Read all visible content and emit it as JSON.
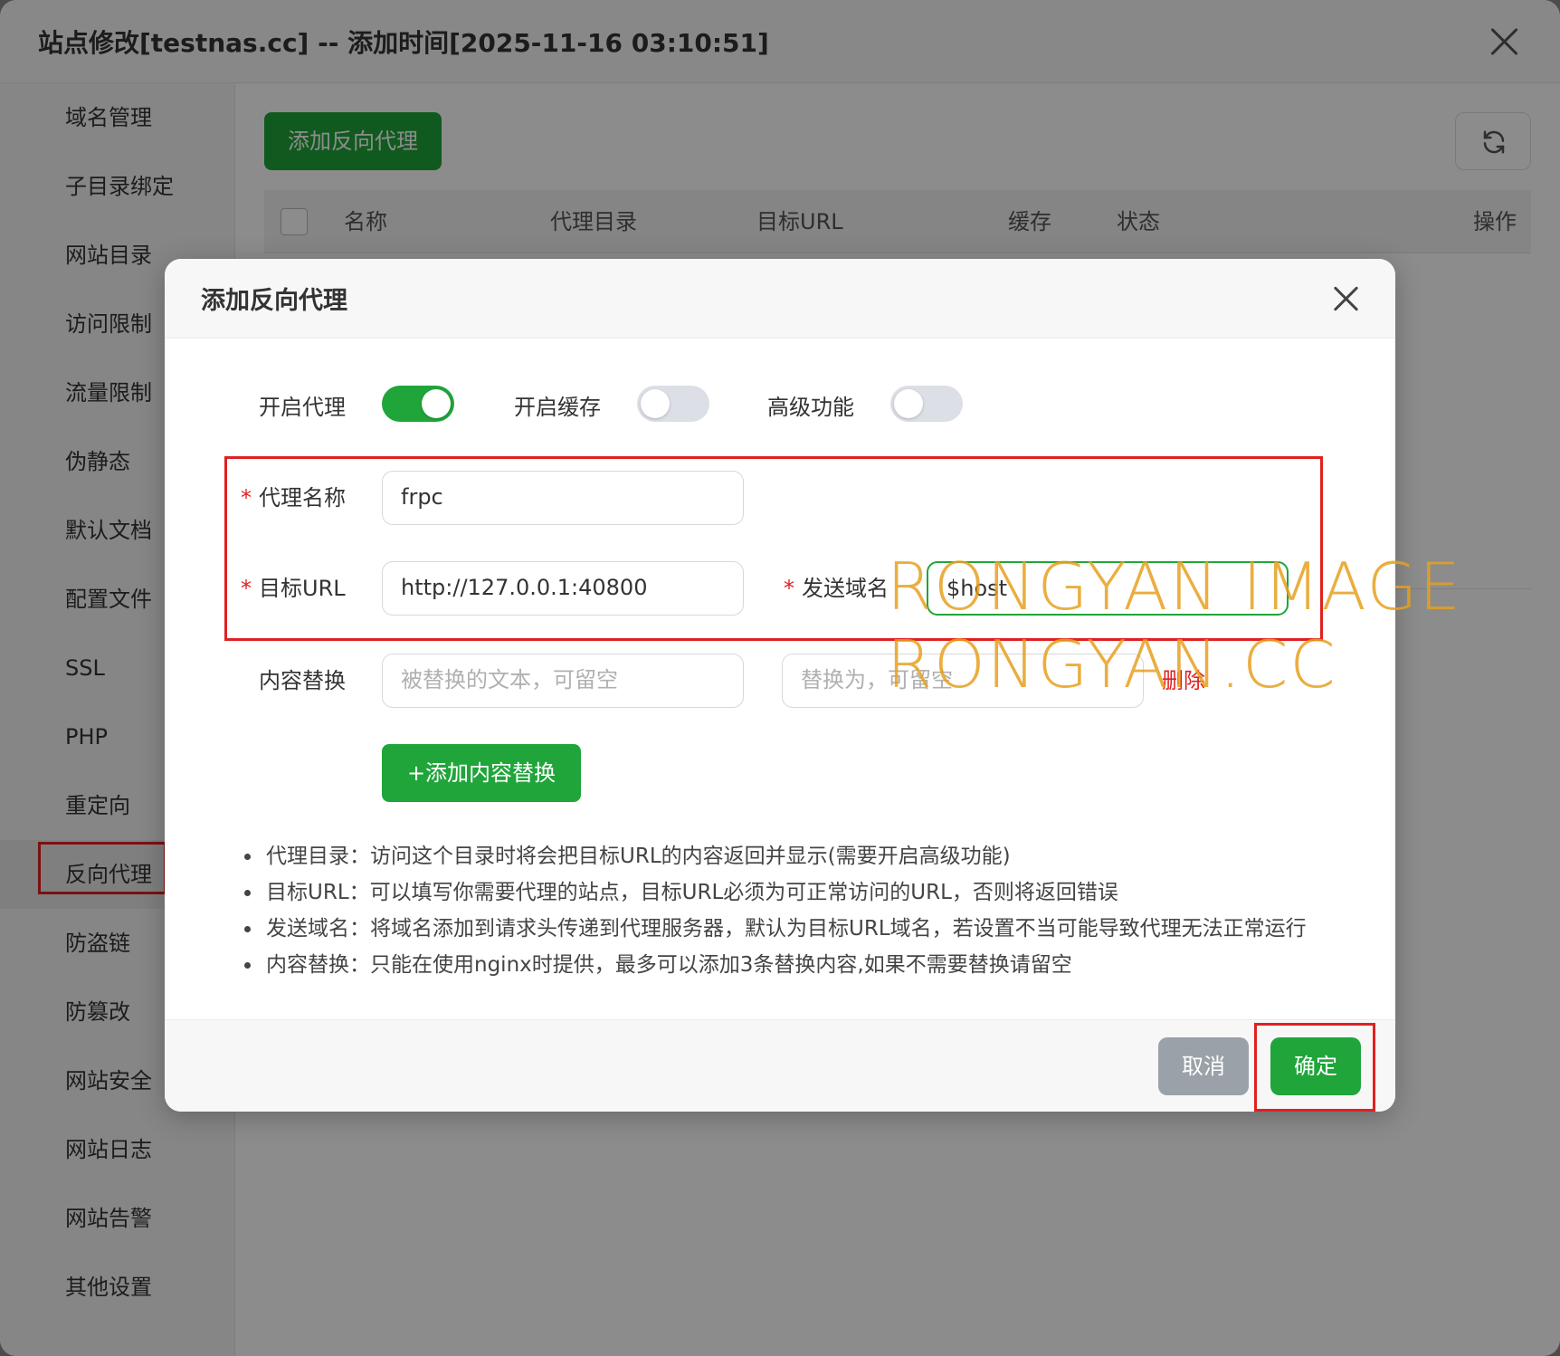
{
  "window": {
    "title": "站点修改[testnas.cc] -- 添加时间[2025-11-16 03:10:51]"
  },
  "sidebar": {
    "items": [
      {
        "label": "域名管理"
      },
      {
        "label": "子目录绑定"
      },
      {
        "label": "网站目录"
      },
      {
        "label": "访问限制"
      },
      {
        "label": "流量限制"
      },
      {
        "label": "伪静态"
      },
      {
        "label": "默认文档"
      },
      {
        "label": "配置文件"
      },
      {
        "label": "SSL"
      },
      {
        "label": "PHP"
      },
      {
        "label": "重定向"
      },
      {
        "label": "反向代理"
      },
      {
        "label": "防盗链"
      },
      {
        "label": "防篡改"
      },
      {
        "label": "网站安全"
      },
      {
        "label": "网站日志"
      },
      {
        "label": "网站告警"
      },
      {
        "label": "其他设置"
      }
    ],
    "active": "反向代理"
  },
  "main": {
    "add_button": "添加反向代理",
    "refresh_icon": "refresh-icon",
    "table_headers": [
      "名称",
      "代理目录",
      "目标URL",
      "缓存",
      "状态",
      "操作"
    ]
  },
  "modal": {
    "title": "添加反向代理",
    "toggles": [
      {
        "label": "开启代理",
        "on": true
      },
      {
        "label": "开启缓存",
        "on": false
      },
      {
        "label": "高级功能",
        "on": false
      }
    ],
    "proxy_name": {
      "label": "代理名称",
      "value": "frpc"
    },
    "target_url": {
      "label": "目标URL",
      "value": "http://127.0.0.1:40800"
    },
    "send_domain": {
      "label": "发送域名",
      "value": "$host"
    },
    "content_replace": {
      "label": "内容替换",
      "from_placeholder": "被替换的文本，可留空",
      "to_placeholder": "替换为，可留空",
      "delete_label": "删除"
    },
    "add_content_button": "+添加内容替换",
    "notes": [
      "代理目录：访问这个目录时将会把目标URL的内容返回并显示(需要开启高级功能)",
      "目标URL：可以填写你需要代理的站点，目标URL必须为可正常访问的URL，否则将返回错误",
      "发送域名：将域名添加到请求头传递到代理服务器，默认为目标URL域名，若设置不当可能导致代理无法正常运行",
      "内容替换：只能在使用nginx时提供，最多可以添加3条替换内容,如果不需要替换请留空"
    ],
    "cancel_button": "取消",
    "ok_button": "确定"
  },
  "watermark": {
    "line1": "RONGYAN IMAGE",
    "line2": "RONGYAN.CC"
  },
  "colors": {
    "accent": "#20a53a",
    "highlight": "#e02020",
    "cancel": "#9aa1a8",
    "watermark": "#e6a01e"
  }
}
